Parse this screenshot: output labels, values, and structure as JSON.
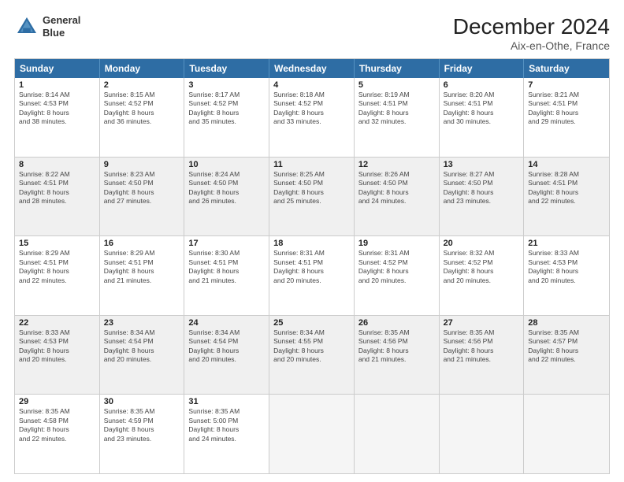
{
  "header": {
    "logo_line1": "General",
    "logo_line2": "Blue",
    "month": "December 2024",
    "location": "Aix-en-Othe, France"
  },
  "days_of_week": [
    "Sunday",
    "Monday",
    "Tuesday",
    "Wednesday",
    "Thursday",
    "Friday",
    "Saturday"
  ],
  "rows": [
    [
      {
        "day": "1",
        "lines": [
          "Sunrise: 8:14 AM",
          "Sunset: 4:53 PM",
          "Daylight: 8 hours",
          "and 38 minutes."
        ],
        "shade": false
      },
      {
        "day": "2",
        "lines": [
          "Sunrise: 8:15 AM",
          "Sunset: 4:52 PM",
          "Daylight: 8 hours",
          "and 36 minutes."
        ],
        "shade": false
      },
      {
        "day": "3",
        "lines": [
          "Sunrise: 8:17 AM",
          "Sunset: 4:52 PM",
          "Daylight: 8 hours",
          "and 35 minutes."
        ],
        "shade": false
      },
      {
        "day": "4",
        "lines": [
          "Sunrise: 8:18 AM",
          "Sunset: 4:52 PM",
          "Daylight: 8 hours",
          "and 33 minutes."
        ],
        "shade": false
      },
      {
        "day": "5",
        "lines": [
          "Sunrise: 8:19 AM",
          "Sunset: 4:51 PM",
          "Daylight: 8 hours",
          "and 32 minutes."
        ],
        "shade": false
      },
      {
        "day": "6",
        "lines": [
          "Sunrise: 8:20 AM",
          "Sunset: 4:51 PM",
          "Daylight: 8 hours",
          "and 30 minutes."
        ],
        "shade": false
      },
      {
        "day": "7",
        "lines": [
          "Sunrise: 8:21 AM",
          "Sunset: 4:51 PM",
          "Daylight: 8 hours",
          "and 29 minutes."
        ],
        "shade": false
      }
    ],
    [
      {
        "day": "8",
        "lines": [
          "Sunrise: 8:22 AM",
          "Sunset: 4:51 PM",
          "Daylight: 8 hours",
          "and 28 minutes."
        ],
        "shade": true
      },
      {
        "day": "9",
        "lines": [
          "Sunrise: 8:23 AM",
          "Sunset: 4:50 PM",
          "Daylight: 8 hours",
          "and 27 minutes."
        ],
        "shade": true
      },
      {
        "day": "10",
        "lines": [
          "Sunrise: 8:24 AM",
          "Sunset: 4:50 PM",
          "Daylight: 8 hours",
          "and 26 minutes."
        ],
        "shade": true
      },
      {
        "day": "11",
        "lines": [
          "Sunrise: 8:25 AM",
          "Sunset: 4:50 PM",
          "Daylight: 8 hours",
          "and 25 minutes."
        ],
        "shade": true
      },
      {
        "day": "12",
        "lines": [
          "Sunrise: 8:26 AM",
          "Sunset: 4:50 PM",
          "Daylight: 8 hours",
          "and 24 minutes."
        ],
        "shade": true
      },
      {
        "day": "13",
        "lines": [
          "Sunrise: 8:27 AM",
          "Sunset: 4:50 PM",
          "Daylight: 8 hours",
          "and 23 minutes."
        ],
        "shade": true
      },
      {
        "day": "14",
        "lines": [
          "Sunrise: 8:28 AM",
          "Sunset: 4:51 PM",
          "Daylight: 8 hours",
          "and 22 minutes."
        ],
        "shade": true
      }
    ],
    [
      {
        "day": "15",
        "lines": [
          "Sunrise: 8:29 AM",
          "Sunset: 4:51 PM",
          "Daylight: 8 hours",
          "and 22 minutes."
        ],
        "shade": false
      },
      {
        "day": "16",
        "lines": [
          "Sunrise: 8:29 AM",
          "Sunset: 4:51 PM",
          "Daylight: 8 hours",
          "and 21 minutes."
        ],
        "shade": false
      },
      {
        "day": "17",
        "lines": [
          "Sunrise: 8:30 AM",
          "Sunset: 4:51 PM",
          "Daylight: 8 hours",
          "and 21 minutes."
        ],
        "shade": false
      },
      {
        "day": "18",
        "lines": [
          "Sunrise: 8:31 AM",
          "Sunset: 4:51 PM",
          "Daylight: 8 hours",
          "and 20 minutes."
        ],
        "shade": false
      },
      {
        "day": "19",
        "lines": [
          "Sunrise: 8:31 AM",
          "Sunset: 4:52 PM",
          "Daylight: 8 hours",
          "and 20 minutes."
        ],
        "shade": false
      },
      {
        "day": "20",
        "lines": [
          "Sunrise: 8:32 AM",
          "Sunset: 4:52 PM",
          "Daylight: 8 hours",
          "and 20 minutes."
        ],
        "shade": false
      },
      {
        "day": "21",
        "lines": [
          "Sunrise: 8:33 AM",
          "Sunset: 4:53 PM",
          "Daylight: 8 hours",
          "and 20 minutes."
        ],
        "shade": false
      }
    ],
    [
      {
        "day": "22",
        "lines": [
          "Sunrise: 8:33 AM",
          "Sunset: 4:53 PM",
          "Daylight: 8 hours",
          "and 20 minutes."
        ],
        "shade": true
      },
      {
        "day": "23",
        "lines": [
          "Sunrise: 8:34 AM",
          "Sunset: 4:54 PM",
          "Daylight: 8 hours",
          "and 20 minutes."
        ],
        "shade": true
      },
      {
        "day": "24",
        "lines": [
          "Sunrise: 8:34 AM",
          "Sunset: 4:54 PM",
          "Daylight: 8 hours",
          "and 20 minutes."
        ],
        "shade": true
      },
      {
        "day": "25",
        "lines": [
          "Sunrise: 8:34 AM",
          "Sunset: 4:55 PM",
          "Daylight: 8 hours",
          "and 20 minutes."
        ],
        "shade": true
      },
      {
        "day": "26",
        "lines": [
          "Sunrise: 8:35 AM",
          "Sunset: 4:56 PM",
          "Daylight: 8 hours",
          "and 21 minutes."
        ],
        "shade": true
      },
      {
        "day": "27",
        "lines": [
          "Sunrise: 8:35 AM",
          "Sunset: 4:56 PM",
          "Daylight: 8 hours",
          "and 21 minutes."
        ],
        "shade": true
      },
      {
        "day": "28",
        "lines": [
          "Sunrise: 8:35 AM",
          "Sunset: 4:57 PM",
          "Daylight: 8 hours",
          "and 22 minutes."
        ],
        "shade": true
      }
    ],
    [
      {
        "day": "29",
        "lines": [
          "Sunrise: 8:35 AM",
          "Sunset: 4:58 PM",
          "Daylight: 8 hours",
          "and 22 minutes."
        ],
        "shade": false
      },
      {
        "day": "30",
        "lines": [
          "Sunrise: 8:35 AM",
          "Sunset: 4:59 PM",
          "Daylight: 8 hours",
          "and 23 minutes."
        ],
        "shade": false
      },
      {
        "day": "31",
        "lines": [
          "Sunrise: 8:35 AM",
          "Sunset: 5:00 PM",
          "Daylight: 8 hours",
          "and 24 minutes."
        ],
        "shade": false
      },
      {
        "day": "",
        "lines": [],
        "shade": true,
        "empty": true
      },
      {
        "day": "",
        "lines": [],
        "shade": true,
        "empty": true
      },
      {
        "day": "",
        "lines": [],
        "shade": true,
        "empty": true
      },
      {
        "day": "",
        "lines": [],
        "shade": true,
        "empty": true
      }
    ]
  ]
}
